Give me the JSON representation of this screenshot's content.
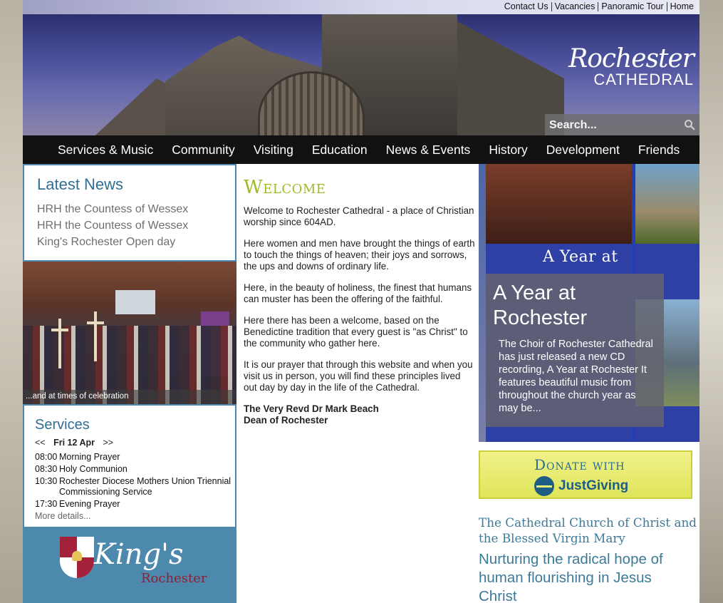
{
  "toplinks": [
    "Contact Us",
    "Vacancies",
    "Panoramic Tour",
    "Home"
  ],
  "logo": {
    "line1": "Rochester",
    "line2": "CATHEDRAL"
  },
  "search": {
    "placeholder": "Search..."
  },
  "nav": [
    "Services & Music",
    "Community",
    "Visiting",
    "Education",
    "News & Events",
    "History",
    "Development",
    "Friends"
  ],
  "latest_news": {
    "title": "Latest News",
    "items": [
      "HRH the Countess of Wessex",
      "HRH the Countess of Wessex",
      "King's Rochester Open day"
    ]
  },
  "photo_caption": "...and at times of celebration",
  "services": {
    "title": "Services",
    "prev": "<<",
    "date": "Fri 12 Apr",
    "next": ">>",
    "rows": [
      {
        "time": "08:00",
        "name": "Morning Prayer"
      },
      {
        "time": "08:30",
        "name": "Holy Communion"
      },
      {
        "time": "10:30",
        "name": "Rochester Diocese Mothers Union Triennial Commissioning Service"
      },
      {
        "time": "17:30",
        "name": "Evening Prayer"
      }
    ],
    "more": "More details..."
  },
  "kings": {
    "name": "King's",
    "place": "Rochester"
  },
  "welcome": {
    "title": "Welcome",
    "paragraphs": [
      "Welcome to Rochester Cathedral - a place of Christian worship since 604AD.",
      "Here women and men have brought the things of earth to touch the things of heaven; their joys and sorrows, the ups and downs of ordinary life.",
      "Here, in the beauty of holiness, the finest that humans can muster has been the offering of the faithful.",
      "Here there has been a welcome, based on the Benedictine tradition that every guest is \"as Christ\" to the community who gather here.",
      "It is our prayer that through this website and when you visit us in person, you will find these principles lived out day by day in the life of the Cathedral."
    ],
    "signature_name": "The Very Revd Dr Mark Beach",
    "signature_role": "Dean of Rochester"
  },
  "feature": {
    "cover_title": "A Year at",
    "title": "A Year at Rochester",
    "text": "The Choir of Rochester Cathedral has just released a new CD recording,   A Year at Rochester It features beautiful music from throughout the church year as may be..."
  },
  "donate": {
    "line1": "Donate with",
    "line2": "JustGiving"
  },
  "dedication": "The Cathedral Church of Christ and the Blessed Virgin Mary",
  "motto": "Nurturing the radical hope of human flourishing in Jesus Christ"
}
